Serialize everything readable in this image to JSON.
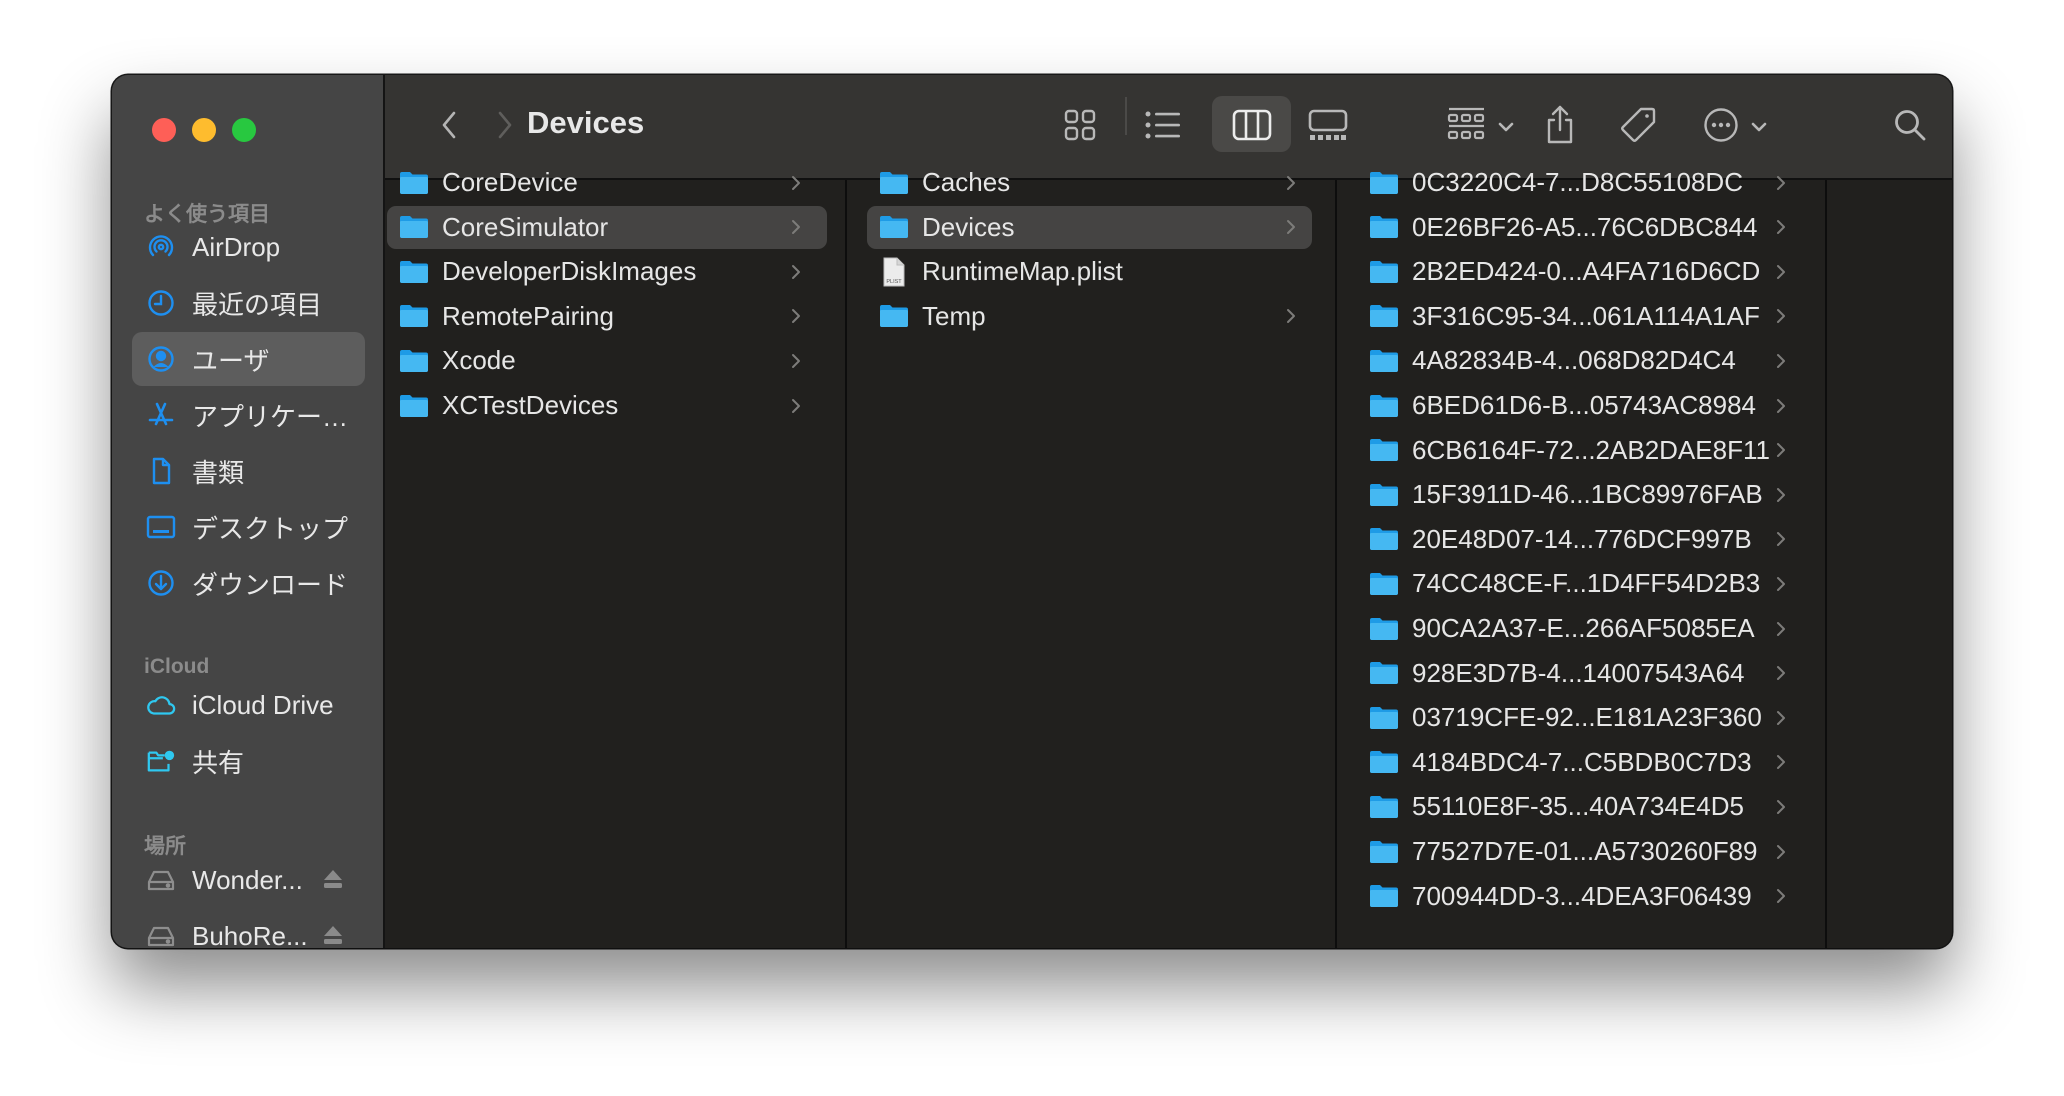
{
  "window": {
    "title": "Devices",
    "traffic_lights": {
      "close": "#fe5f57",
      "minimize": "#febc2e",
      "maximize": "#28c840"
    }
  },
  "colors": {
    "accent_blue": "#1e8ff0",
    "icloud_cyan": "#2fc8f0",
    "folder_blue": "#3ab2ef",
    "sidebar_bg": "#454545",
    "toolbar_bg": "#353432",
    "content_bg": "#21201e"
  },
  "sidebar": {
    "sections": [
      {
        "header": "よく使う項目",
        "items": [
          {
            "label": "AirDrop",
            "icon": "airdrop-icon",
            "selected": false
          },
          {
            "label": "最近の項目",
            "icon": "clock-icon",
            "selected": false
          },
          {
            "label": "ユーザ",
            "icon": "user-icon",
            "selected": true
          },
          {
            "label": "アプリケー…",
            "icon": "applications-icon",
            "selected": false
          },
          {
            "label": "書類",
            "icon": "document-icon",
            "selected": false
          },
          {
            "label": "デスクトップ",
            "icon": "desktop-icon",
            "selected": false
          },
          {
            "label": "ダウンロード",
            "icon": "download-icon",
            "selected": false
          }
        ]
      },
      {
        "header": "iCloud",
        "items": [
          {
            "label": "iCloud Drive",
            "icon": "cloud-icon",
            "selected": false
          },
          {
            "label": "共有",
            "icon": "shared-folder-icon",
            "selected": false
          }
        ]
      },
      {
        "header": "場所",
        "items": [
          {
            "label": "Wonder...",
            "icon": "drive-icon",
            "eject": true
          },
          {
            "label": "BuhoRe...",
            "icon": "drive-icon",
            "eject": true
          }
        ]
      }
    ]
  },
  "toolbar": {
    "back": "back-chevron-icon",
    "forward": "forward-chevron-icon",
    "title": "Devices",
    "view_modes": [
      "icon-view",
      "list-view",
      "column-view",
      "gallery-view"
    ],
    "active_view": "column-view",
    "group": "group-by-icon",
    "share": "share-icon",
    "tags": "tag-icon",
    "more": "more-actions-icon",
    "search": "search-icon"
  },
  "columns": [
    {
      "items": [
        {
          "name": "CoreDevice",
          "type": "folder",
          "selected": false
        },
        {
          "name": "CoreSimulator",
          "type": "folder",
          "selected": true
        },
        {
          "name": "DeveloperDiskImages",
          "type": "folder",
          "selected": false
        },
        {
          "name": "RemotePairing",
          "type": "folder",
          "selected": false
        },
        {
          "name": "Xcode",
          "type": "folder",
          "selected": false
        },
        {
          "name": "XCTestDevices",
          "type": "folder",
          "selected": false
        }
      ]
    },
    {
      "items": [
        {
          "name": "Caches",
          "type": "folder",
          "selected": false
        },
        {
          "name": "Devices",
          "type": "folder",
          "selected": true
        },
        {
          "name": "RuntimeMap.plist",
          "type": "plist",
          "selected": false,
          "badge": "PLIST"
        },
        {
          "name": "Temp",
          "type": "folder",
          "selected": false
        }
      ]
    },
    {
      "items": [
        {
          "name": "0C3220C4-7...D8C55108DC",
          "type": "folder"
        },
        {
          "name": "0E26BF26-A5...76C6DBC844",
          "type": "folder"
        },
        {
          "name": "2B2ED424-0...A4FA716D6CD",
          "type": "folder"
        },
        {
          "name": "3F316C95-34...061A114A1AF",
          "type": "folder"
        },
        {
          "name": "4A82834B-4...068D82D4C4",
          "type": "folder"
        },
        {
          "name": "6BED61D6-B...05743AC8984",
          "type": "folder"
        },
        {
          "name": "6CB6164F-72...2AB2DAE8F11",
          "type": "folder"
        },
        {
          "name": "15F3911D-46...1BC89976FAB",
          "type": "folder"
        },
        {
          "name": "20E48D07-14...776DCF997B",
          "type": "folder"
        },
        {
          "name": "74CC48CE-F...1D4FF54D2B3",
          "type": "folder"
        },
        {
          "name": "90CA2A37-E...266AF5085EA",
          "type": "folder"
        },
        {
          "name": "928E3D7B-4...14007543A64",
          "type": "folder"
        },
        {
          "name": "03719CFE-92...E181A23F360",
          "type": "folder"
        },
        {
          "name": "4184BDC4-7...C5BDB0C7D3",
          "type": "folder"
        },
        {
          "name": "55110E8F-35...40A734E4D5",
          "type": "folder"
        },
        {
          "name": "77527D7E-01...A5730260F89",
          "type": "folder"
        },
        {
          "name": "700944DD-3...4DEA3F06439",
          "type": "folder"
        }
      ]
    },
    {
      "items": []
    }
  ]
}
